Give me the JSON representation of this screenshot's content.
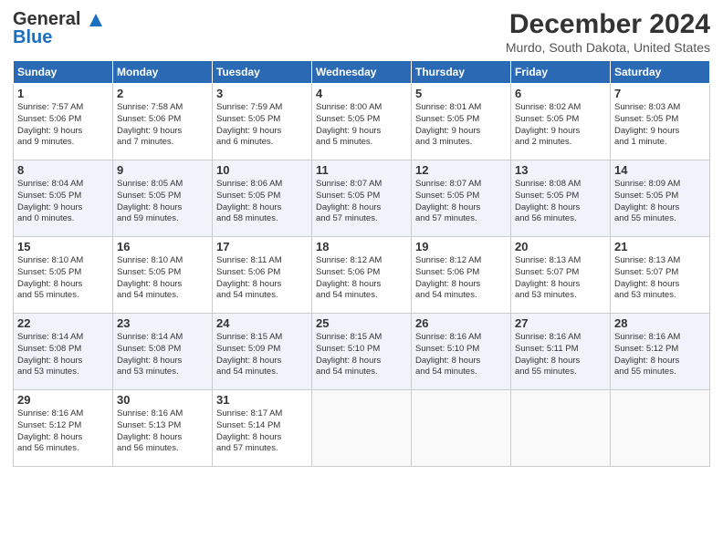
{
  "header": {
    "logo_line1": "General",
    "logo_line2": "Blue",
    "month": "December 2024",
    "location": "Murdo, South Dakota, United States"
  },
  "weekdays": [
    "Sunday",
    "Monday",
    "Tuesday",
    "Wednesday",
    "Thursday",
    "Friday",
    "Saturday"
  ],
  "weeks": [
    [
      {
        "day": "1",
        "lines": [
          "Sunrise: 7:57 AM",
          "Sunset: 5:06 PM",
          "Daylight: 9 hours",
          "and 9 minutes."
        ]
      },
      {
        "day": "2",
        "lines": [
          "Sunrise: 7:58 AM",
          "Sunset: 5:06 PM",
          "Daylight: 9 hours",
          "and 7 minutes."
        ]
      },
      {
        "day": "3",
        "lines": [
          "Sunrise: 7:59 AM",
          "Sunset: 5:05 PM",
          "Daylight: 9 hours",
          "and 6 minutes."
        ]
      },
      {
        "day": "4",
        "lines": [
          "Sunrise: 8:00 AM",
          "Sunset: 5:05 PM",
          "Daylight: 9 hours",
          "and 5 minutes."
        ]
      },
      {
        "day": "5",
        "lines": [
          "Sunrise: 8:01 AM",
          "Sunset: 5:05 PM",
          "Daylight: 9 hours",
          "and 3 minutes."
        ]
      },
      {
        "day": "6",
        "lines": [
          "Sunrise: 8:02 AM",
          "Sunset: 5:05 PM",
          "Daylight: 9 hours",
          "and 2 minutes."
        ]
      },
      {
        "day": "7",
        "lines": [
          "Sunrise: 8:03 AM",
          "Sunset: 5:05 PM",
          "Daylight: 9 hours",
          "and 1 minute."
        ]
      }
    ],
    [
      {
        "day": "8",
        "lines": [
          "Sunrise: 8:04 AM",
          "Sunset: 5:05 PM",
          "Daylight: 9 hours",
          "and 0 minutes."
        ]
      },
      {
        "day": "9",
        "lines": [
          "Sunrise: 8:05 AM",
          "Sunset: 5:05 PM",
          "Daylight: 8 hours",
          "and 59 minutes."
        ]
      },
      {
        "day": "10",
        "lines": [
          "Sunrise: 8:06 AM",
          "Sunset: 5:05 PM",
          "Daylight: 8 hours",
          "and 58 minutes."
        ]
      },
      {
        "day": "11",
        "lines": [
          "Sunrise: 8:07 AM",
          "Sunset: 5:05 PM",
          "Daylight: 8 hours",
          "and 57 minutes."
        ]
      },
      {
        "day": "12",
        "lines": [
          "Sunrise: 8:07 AM",
          "Sunset: 5:05 PM",
          "Daylight: 8 hours",
          "and 57 minutes."
        ]
      },
      {
        "day": "13",
        "lines": [
          "Sunrise: 8:08 AM",
          "Sunset: 5:05 PM",
          "Daylight: 8 hours",
          "and 56 minutes."
        ]
      },
      {
        "day": "14",
        "lines": [
          "Sunrise: 8:09 AM",
          "Sunset: 5:05 PM",
          "Daylight: 8 hours",
          "and 55 minutes."
        ]
      }
    ],
    [
      {
        "day": "15",
        "lines": [
          "Sunrise: 8:10 AM",
          "Sunset: 5:05 PM",
          "Daylight: 8 hours",
          "and 55 minutes."
        ]
      },
      {
        "day": "16",
        "lines": [
          "Sunrise: 8:10 AM",
          "Sunset: 5:05 PM",
          "Daylight: 8 hours",
          "and 54 minutes."
        ]
      },
      {
        "day": "17",
        "lines": [
          "Sunrise: 8:11 AM",
          "Sunset: 5:06 PM",
          "Daylight: 8 hours",
          "and 54 minutes."
        ]
      },
      {
        "day": "18",
        "lines": [
          "Sunrise: 8:12 AM",
          "Sunset: 5:06 PM",
          "Daylight: 8 hours",
          "and 54 minutes."
        ]
      },
      {
        "day": "19",
        "lines": [
          "Sunrise: 8:12 AM",
          "Sunset: 5:06 PM",
          "Daylight: 8 hours",
          "and 54 minutes."
        ]
      },
      {
        "day": "20",
        "lines": [
          "Sunrise: 8:13 AM",
          "Sunset: 5:07 PM",
          "Daylight: 8 hours",
          "and 53 minutes."
        ]
      },
      {
        "day": "21",
        "lines": [
          "Sunrise: 8:13 AM",
          "Sunset: 5:07 PM",
          "Daylight: 8 hours",
          "and 53 minutes."
        ]
      }
    ],
    [
      {
        "day": "22",
        "lines": [
          "Sunrise: 8:14 AM",
          "Sunset: 5:08 PM",
          "Daylight: 8 hours",
          "and 53 minutes."
        ]
      },
      {
        "day": "23",
        "lines": [
          "Sunrise: 8:14 AM",
          "Sunset: 5:08 PM",
          "Daylight: 8 hours",
          "and 53 minutes."
        ]
      },
      {
        "day": "24",
        "lines": [
          "Sunrise: 8:15 AM",
          "Sunset: 5:09 PM",
          "Daylight: 8 hours",
          "and 54 minutes."
        ]
      },
      {
        "day": "25",
        "lines": [
          "Sunrise: 8:15 AM",
          "Sunset: 5:10 PM",
          "Daylight: 8 hours",
          "and 54 minutes."
        ]
      },
      {
        "day": "26",
        "lines": [
          "Sunrise: 8:16 AM",
          "Sunset: 5:10 PM",
          "Daylight: 8 hours",
          "and 54 minutes."
        ]
      },
      {
        "day": "27",
        "lines": [
          "Sunrise: 8:16 AM",
          "Sunset: 5:11 PM",
          "Daylight: 8 hours",
          "and 55 minutes."
        ]
      },
      {
        "day": "28",
        "lines": [
          "Sunrise: 8:16 AM",
          "Sunset: 5:12 PM",
          "Daylight: 8 hours",
          "and 55 minutes."
        ]
      }
    ],
    [
      {
        "day": "29",
        "lines": [
          "Sunrise: 8:16 AM",
          "Sunset: 5:12 PM",
          "Daylight: 8 hours",
          "and 56 minutes."
        ]
      },
      {
        "day": "30",
        "lines": [
          "Sunrise: 8:16 AM",
          "Sunset: 5:13 PM",
          "Daylight: 8 hours",
          "and 56 minutes."
        ]
      },
      {
        "day": "31",
        "lines": [
          "Sunrise: 8:17 AM",
          "Sunset: 5:14 PM",
          "Daylight: 8 hours",
          "and 57 minutes."
        ]
      },
      null,
      null,
      null,
      null
    ]
  ]
}
